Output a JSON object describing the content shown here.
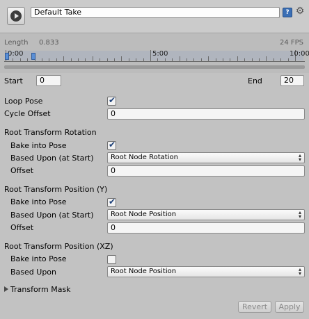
{
  "header": {
    "take_name": "Default Take",
    "icons": {
      "play": "play-icon",
      "help": "help-icon",
      "settings": "gear-icon"
    }
  },
  "timeline": {
    "length_label": "Length",
    "length_value": "0.833",
    "fps": "24 FPS",
    "ticks": [
      "0:00",
      "5:00",
      "10:00"
    ]
  },
  "range": {
    "start_label": "Start",
    "start_value": "0",
    "end_label": "End",
    "end_value": "20"
  },
  "loop": {
    "loop_pose_label": "Loop Pose",
    "loop_pose_checked": true,
    "cycle_offset_label": "Cycle Offset",
    "cycle_offset_value": "0"
  },
  "rotation": {
    "title": "Root Transform Rotation",
    "bake_label": "Bake into Pose",
    "bake_checked": true,
    "based_label": "Based Upon (at Start)",
    "based_value": "Root Node Rotation",
    "offset_label": "Offset",
    "offset_value": "0"
  },
  "position_y": {
    "title": "Root Transform Position (Y)",
    "bake_label": "Bake into Pose",
    "bake_checked": true,
    "based_label": "Based Upon (at Start)",
    "based_value": "Root Node Position",
    "offset_label": "Offset",
    "offset_value": "0"
  },
  "position_xz": {
    "title": "Root Transform Position (XZ)",
    "bake_label": "Bake into Pose",
    "bake_checked": false,
    "based_label": "Based Upon",
    "based_value": "Root Node Position"
  },
  "mask": {
    "label": "Transform Mask"
  },
  "footer": {
    "revert_label": "Revert",
    "apply_label": "Apply"
  }
}
